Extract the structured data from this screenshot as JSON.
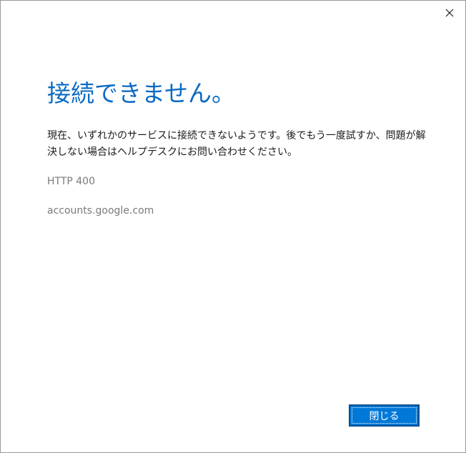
{
  "window": {
    "close_icon": "close-icon"
  },
  "dialog": {
    "title": "接続できません。",
    "message": "現在、いずれかのサービスに接続できないようです。後でもう一度試すか、問題が解決しない場合はヘルプデスクにお問い合わせください。",
    "error_code": "HTTP 400",
    "domain": "accounts.google.com"
  },
  "buttons": {
    "close_label": "閉じる"
  },
  "colors": {
    "accent": "#0078d7",
    "title": "#0b6ac2"
  }
}
